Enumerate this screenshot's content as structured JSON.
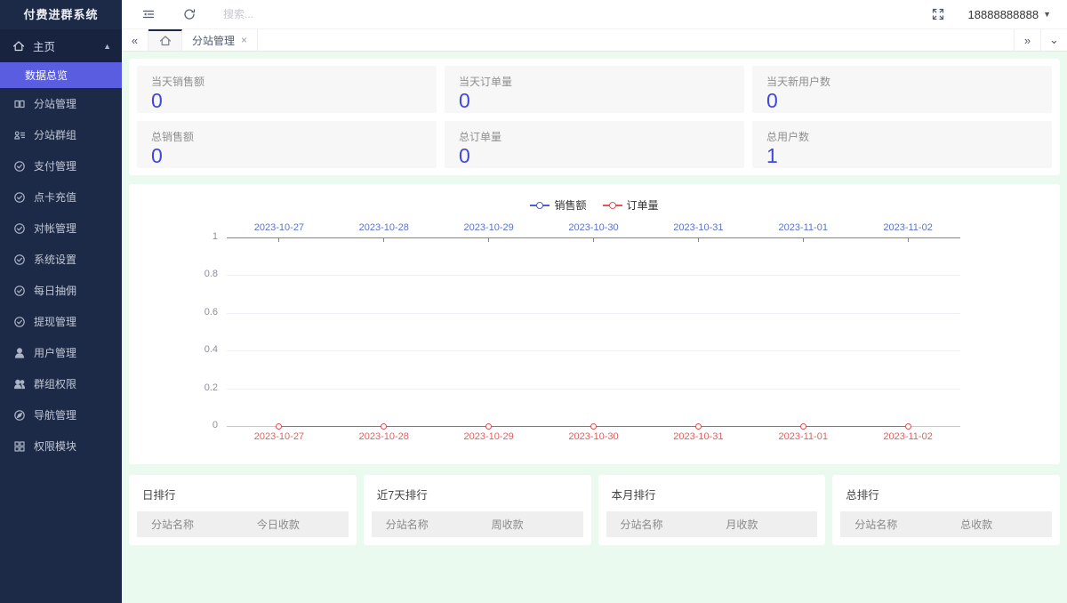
{
  "app": {
    "accent_purple": "#5a5de0",
    "sidebar_bg": "#1d2a47",
    "content_bg": "#ebfaee",
    "stat_value_color": "#4046dd"
  },
  "sidebar": {
    "title": "付费进群系统",
    "home": {
      "label": "主页",
      "icon": "home-icon"
    },
    "active_sub": {
      "label": "数据总览"
    },
    "items": [
      {
        "label": "分站管理",
        "icon": "substation-icon"
      },
      {
        "label": "分站群组",
        "icon": "group-list-icon"
      },
      {
        "label": "支付管理",
        "icon": "circle-check-icon"
      },
      {
        "label": "点卡充值",
        "icon": "circle-check-icon"
      },
      {
        "label": "对帐管理",
        "icon": "circle-check-icon"
      },
      {
        "label": "系统设置",
        "icon": "circle-check-icon"
      },
      {
        "label": "每日抽佣",
        "icon": "circle-check-icon"
      },
      {
        "label": "提现管理",
        "icon": "circle-check-icon"
      },
      {
        "label": "用户管理",
        "icon": "user-icon"
      },
      {
        "label": "群组权限",
        "icon": "users-icon"
      },
      {
        "label": "导航管理",
        "icon": "nav-icon"
      },
      {
        "label": "权限模块",
        "icon": "modules-icon"
      }
    ]
  },
  "header": {
    "search_placeholder": "搜索...",
    "phone": "18888888888",
    "icons": [
      "collapse-menu-icon",
      "refresh-icon",
      "fullscreen-icon",
      "caret-down-icon"
    ]
  },
  "tabbar": {
    "back": "«",
    "forward": "»",
    "home_icon": "home-icon",
    "tab": {
      "label": "分站管理",
      "close": "×"
    }
  },
  "stats": [
    {
      "label": "当天销售额",
      "value": "0"
    },
    {
      "label": "当天订单量",
      "value": "0"
    },
    {
      "label": "当天新用户数",
      "value": "0"
    },
    {
      "label": "总销售额",
      "value": "0"
    },
    {
      "label": "总订单量",
      "value": "0"
    },
    {
      "label": "总用户数",
      "value": "1"
    }
  ],
  "chart": {
    "legend": [
      {
        "label": "销售额",
        "color": "#4a5fd0"
      },
      {
        "label": "订单量",
        "color": "#e25555"
      }
    ],
    "dates": [
      "2023-10-27",
      "2023-10-28",
      "2023-10-29",
      "2023-10-30",
      "2023-10-31",
      "2023-11-01",
      "2023-11-02"
    ],
    "yticks": [
      "1",
      "0.8",
      "0.6",
      "0.4",
      "0.2",
      "0"
    ]
  },
  "chart_data": {
    "type": "line",
    "x": [
      "2023-10-27",
      "2023-10-28",
      "2023-10-29",
      "2023-10-30",
      "2023-10-31",
      "2023-11-01",
      "2023-11-02"
    ],
    "series": [
      {
        "name": "销售额",
        "color": "#4a5fd0",
        "values": [
          0,
          0,
          0,
          0,
          0,
          0,
          0
        ]
      },
      {
        "name": "订单量",
        "color": "#e25555",
        "values": [
          0,
          0,
          0,
          0,
          0,
          0,
          0
        ]
      }
    ],
    "title": "",
    "xlabel": "",
    "ylabel": "",
    "ylim": [
      0,
      1
    ],
    "grid": true,
    "legend_position": "top-center"
  },
  "rankings": [
    {
      "title": "日排行",
      "col1": "分站名称",
      "col2": "今日收款"
    },
    {
      "title": "近7天排行",
      "col1": "分站名称",
      "col2": "周收款"
    },
    {
      "title": "本月排行",
      "col1": "分站名称",
      "col2": "月收款"
    },
    {
      "title": "总排行",
      "col1": "分站名称",
      "col2": "总收款"
    }
  ]
}
